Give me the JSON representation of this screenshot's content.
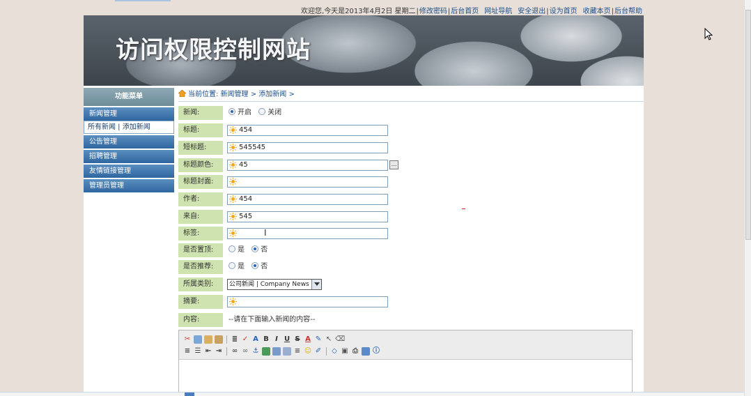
{
  "topbar": {
    "welcome": "欢迎您,今天是2013年4月2日 星期二",
    "links": [
      "修改密码",
      "后台首页",
      "网址导航",
      "安全退出",
      "设为首页",
      "收藏本页",
      "后台帮助"
    ]
  },
  "banner": {
    "title": "访问权限控制网站"
  },
  "sidebar": {
    "title": "功能菜单",
    "items": [
      {
        "label": "新闻管理"
      },
      {
        "label": "所有新闻 | 添加新闻"
      },
      {
        "label": "公告管理"
      },
      {
        "label": "招聘管理"
      },
      {
        "label": "友情链接管理"
      },
      {
        "label": "管理员管理"
      }
    ]
  },
  "breadcrumb": {
    "text": "当前位置: 新闻管理 > 添加新闻 >"
  },
  "form": {
    "news": {
      "label": "新闻:",
      "opt_on": "开启",
      "opt_off": "关闭"
    },
    "title": {
      "label": "标题:",
      "value": "454"
    },
    "short_title": {
      "label": "短标题:",
      "value": "545545"
    },
    "title_color": {
      "label": "标题颜色:",
      "value": "45",
      "button": "..."
    },
    "cover": {
      "label": "标题封面:",
      "value": ""
    },
    "author": {
      "label": "作者:",
      "value": "454"
    },
    "source": {
      "label": "来自:",
      "value": "545"
    },
    "tags": {
      "label": "标签:",
      "value": ""
    },
    "pinned": {
      "label": "是否置顶:",
      "opt_yes": "是",
      "opt_no": "否"
    },
    "recommend": {
      "label": "是否推荐:",
      "opt_yes": "是",
      "opt_no": "否"
    },
    "category": {
      "label": "所属类别:",
      "selected": "公司新闻 | Company News"
    },
    "summary": {
      "label": "摘要:",
      "value": ""
    },
    "content": {
      "label": "内容:",
      "hint": "--请在下面输入新闻的内容--"
    }
  },
  "colors": {
    "accent": "#2f669f",
    "label_bg": "#cfe3b0",
    "link": "#1a4e8c"
  }
}
